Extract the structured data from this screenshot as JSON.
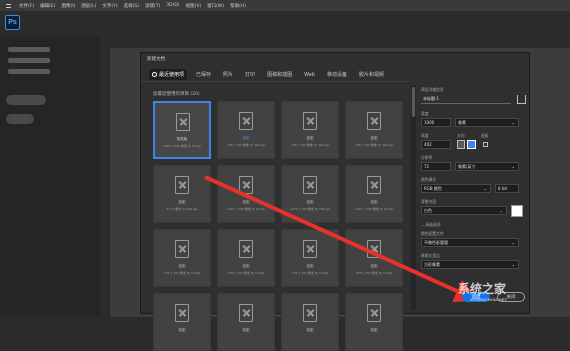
{
  "menubar": [
    "文件(F)",
    "编辑(E)",
    "图像(I)",
    "图层(L)",
    "文字(Y)",
    "选择(S)",
    "滤镜(T)",
    "3D(D)",
    "视图(V)",
    "窗口(W)",
    "帮助(H)"
  ],
  "app": {
    "logo": "Ps"
  },
  "dialog": {
    "title": "新建文档",
    "tabs": [
      "最近使用项",
      "已保存",
      "照片",
      "打印",
      "图稿和插图",
      "Web",
      "移动设备",
      "胶片和视频"
    ],
    "active_tab": 0,
    "section_label": "您最近使用的项目 (20)",
    "presets": [
      {
        "name": "剪贴板",
        "size": "1000 x 402 像素 @ 72 ppi",
        "selected": true
      },
      {
        "name": "自定",
        "size": "700 x 700 像素 @ 300 ppi",
        "highlight": true
      },
      {
        "name": "自定",
        "size": "700 x 700 像素 @ 300 ppi"
      },
      {
        "name": "自定",
        "size": "700 x 700 像素 @ 300 ppi"
      },
      {
        "name": "自定",
        "size": "8 x 8 厘米 @ 300 ppi"
      },
      {
        "name": "自定",
        "size": "1024 x 768 像素 @ 72 ppi"
      },
      {
        "name": "自定",
        "size": "1024 x 768 像素 @ 300 ppi"
      },
      {
        "name": "自定",
        "size": "1024 x 768 像素 @ 72 ppi"
      },
      {
        "name": "自定",
        "size": "701 x 701 像素 @ 72 ppi"
      },
      {
        "name": "自定",
        "size": "700 x 700 像素 @ 72 ppi"
      },
      {
        "name": "自定",
        "size": "701 x 701 像素 @ 72 ppi"
      },
      {
        "name": "自定",
        "size": "255 x 255 像素 @ 72 ppi"
      },
      {
        "name": "自定",
        "size": ""
      },
      {
        "name": "自定",
        "size": ""
      },
      {
        "name": "自定",
        "size": ""
      },
      {
        "name": "自定",
        "size": ""
      }
    ],
    "details": {
      "heading": "预设详细信息",
      "doc_name": "未标题-1",
      "width_label": "宽度",
      "width_value": "1000",
      "width_unit": "像素",
      "height_label": "高度",
      "height_value": "402",
      "orientation_label": "方向",
      "artboard_label": "画板",
      "resolution_label": "分辨率",
      "resolution_value": "72",
      "resolution_unit": "像素/英寸",
      "color_mode_label": "颜色模式",
      "color_mode_value": "RGB 颜色",
      "bit_depth": "8 bit",
      "background_label": "背景内容",
      "background_value": "白色",
      "advanced_label": "高级选项",
      "profile_label": "颜色配置文件",
      "profile_value": "不做色彩管理",
      "pixel_ratio_label": "像素长宽比",
      "pixel_ratio_value": "方形像素"
    },
    "buttons": {
      "create": "创建",
      "close": "关闭"
    }
  },
  "watermark": {
    "main": "系统之家",
    "sub": "XITONGZHIJIA.NET"
  },
  "colors": {
    "accent": "#1473e6",
    "select_border": "#3d84e8",
    "arrow": "#e5322d"
  }
}
